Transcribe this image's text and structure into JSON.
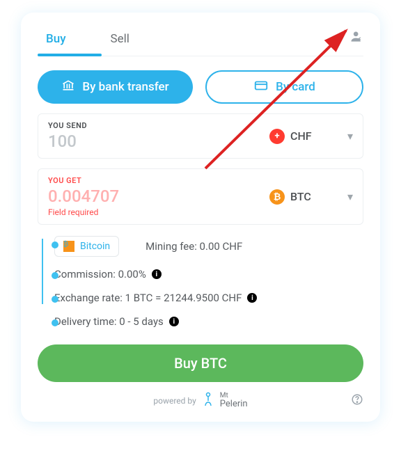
{
  "tabs": {
    "buy": "Buy",
    "sell": "Sell"
  },
  "methods": {
    "bank": "By bank transfer",
    "card": "By card"
  },
  "send": {
    "label": "YOU SEND",
    "value": "100",
    "currency_code": "CHF"
  },
  "get": {
    "label": "YOU GET",
    "value": "0.004707",
    "error": "Field required",
    "currency_code": "BTC"
  },
  "chip": {
    "label": "Bitcoin"
  },
  "fees": {
    "mining": "Mining fee: 0.00 CHF",
    "commission": "Commission: 0.00%",
    "rate": "Exchange rate: 1 BTC = 21244.9500 CHF",
    "delivery": "Delivery time: 0 - 5 days"
  },
  "buy_button": "Buy BTC",
  "footer": {
    "powered": "powered by",
    "brand_top": "Mt",
    "brand_bottom": "Pelerin"
  }
}
